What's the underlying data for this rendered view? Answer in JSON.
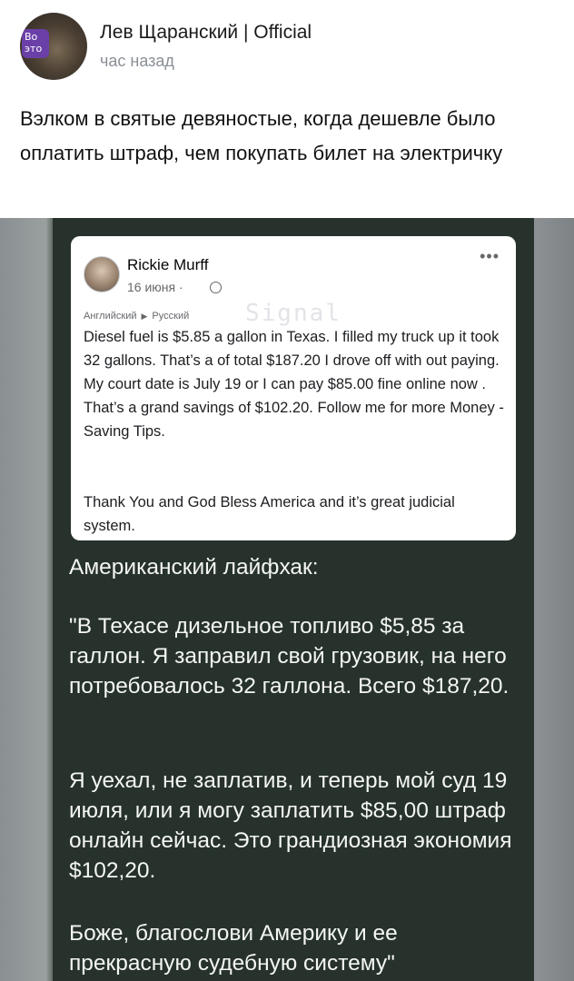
{
  "post": {
    "author": "Лев Щаранский | Official",
    "time": "час назад",
    "avatar_badge": "Во это",
    "text": "Вэлком в святые девяностые, когда дешевле было оплатить штраф, чем покупать билет на электричку"
  },
  "embedded": {
    "fb": {
      "name": "Rickie Murff",
      "date": "16 июня ·",
      "more": "•••",
      "translate_from": "Английский",
      "translate_to": "Русский",
      "watermark": "Signal",
      "body": "Diesel fuel is $5.85 a gallon in Texas. I filled my truck up it took 32 gallons. That’s a of total $187.20 I drove off with out paying. My court date is July 19 or I can pay $85.00 fine online now . That’s a grand savings of $102.20. Follow me for more Money - Saving Tips.",
      "body2": "Thank You and God Bless America and it’s great judicial system."
    },
    "ru": {
      "heading": "Американский лайфхак:",
      "p1": "\"В Техасе дизельное топливо $5,85 за галлон. Я заправил свой грузовик, на него потребовалось 32 галлона. Всего $187,20.",
      "p2": "Я уехал, не заплатив, и теперь мой суд 19 июля, или я могу заплатить $85,00 штраф онлайн сейчас. Это грандиозная экономия $102,20.",
      "p3": "Боже, благослови Америку и ее прекрасную судебную систему\""
    }
  }
}
